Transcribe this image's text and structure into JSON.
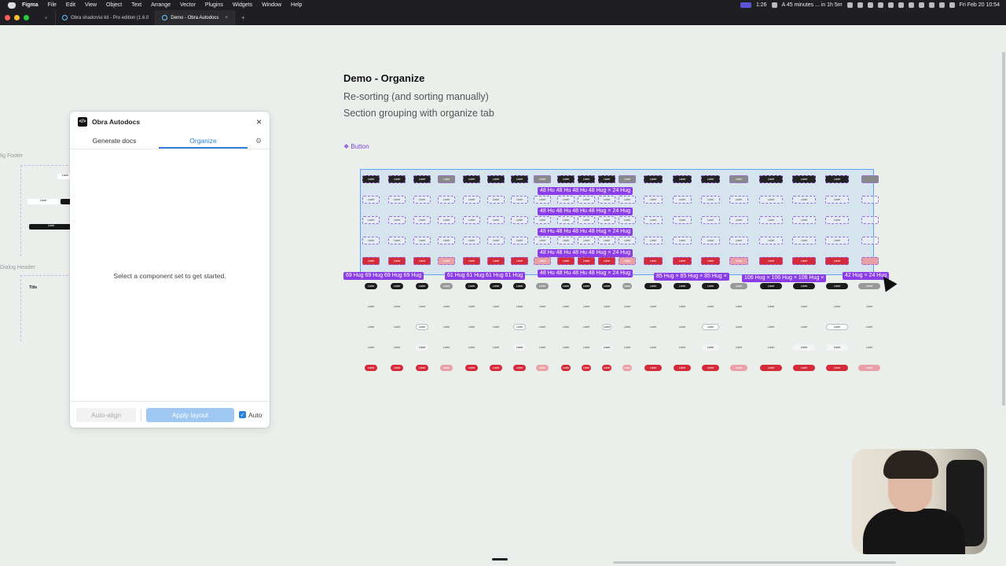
{
  "menubar": {
    "items": [
      "Figma",
      "File",
      "Edit",
      "View",
      "Object",
      "Text",
      "Arrange",
      "Vector",
      "Plugins",
      "Widgets",
      "Window",
      "Help"
    ],
    "status_time": "1:26",
    "status_event": "A 45 minutes ... in 1h 5m",
    "clock": "Fri Feb 20  10:54"
  },
  "tabs": {
    "tab1": "Obra shadcn/ui kit - Pro edition (1.6.0",
    "tab2": "Demo - Obra Autodocs",
    "close": "×",
    "plus": "+"
  },
  "canvas": {
    "heading": "Demo - Organize",
    "sub1": "Re-sorting (and sorting manually)",
    "sub2": "Section grouping with organize tab",
    "button_section": "❖ Button",
    "bg_frame1": "lig Footer",
    "bg_frame2": "Dialog Header",
    "bg_title": "Title",
    "bg_label": "Label"
  },
  "hug_tags": {
    "row1": "48 Hu 48 Hu 48 Hu 48 Hug × 24 Hug",
    "row2": "48 Hu 48 Hu 48 Hu 48 Hug × 24 Hug",
    "row3": "48 Hu 48 Hu 48 Hu 48 Hug × 24 Hug",
    "row4": "48 Hu 48 Hu 48 Hu 48 Hug × 24 Hug",
    "row5a": "69 Hug 69 Hug 69 Hug 69 Hug",
    "row5b": "61 Hug 61 Hug 61 Hug 61 Hug",
    "row5c": "48 Hu 48 Hu 48 Hu 48 Hug × 24 Hug",
    "row5d": "85 Hug × 85 Hug × 85 Hug ×",
    "row5e": "106 Hug × 106 Hug × 106 Hug ×",
    "row5f": "42 Hug × 24 Hug"
  },
  "cell_label": "Label",
  "plugin": {
    "title": "Obra Autodocs",
    "logo": "</>",
    "close": "×",
    "tab_generate": "Generate docs",
    "tab_organize": "Organize",
    "gear": "⚙",
    "empty_message": "Select a component set to get started.",
    "auto_align": "Auto-align",
    "apply": "Apply layout",
    "auto_check_label": "Auto",
    "auto_checked": "✓"
  },
  "colors": {
    "accent": "#2d7fd8",
    "selection": "#5aa5f5",
    "hug_tag": "#8b3ee8",
    "destructive": "#d42a3a"
  }
}
